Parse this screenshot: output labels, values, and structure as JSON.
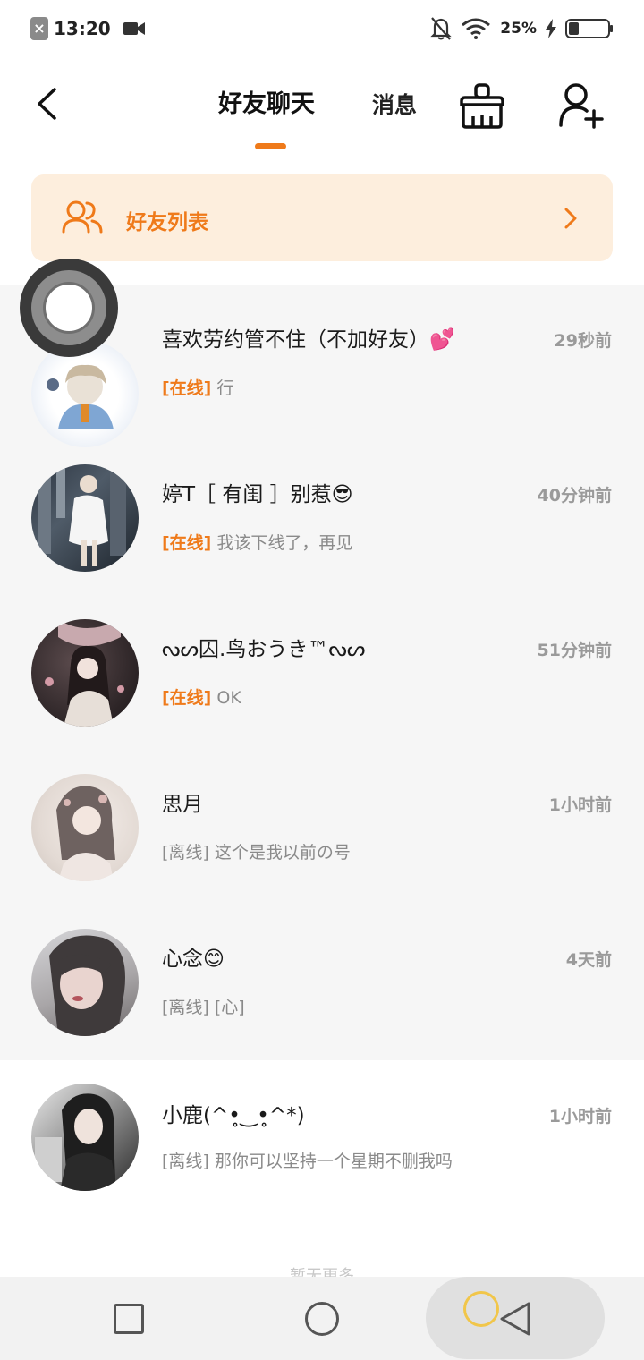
{
  "status_bar": {
    "time": "13:20",
    "battery": "25%"
  },
  "header": {
    "back_icon": "chevron-left-icon",
    "tab_active": "好友聊天",
    "tab_messages": "消息",
    "clean_icon": "broom-icon",
    "add_friend_icon": "add-user-icon"
  },
  "banner": {
    "label": "好友列表",
    "icon": "users-icon"
  },
  "chats": [
    {
      "name": "喜欢劳约管不住（不加好友）💕",
      "time": "29秒前",
      "status": "[在线]",
      "online": true,
      "message": "行"
    },
    {
      "name": "婷T［ 有闺 ］别惹😎",
      "time": "40分钟前",
      "status": "[在线]",
      "online": true,
      "message": "我该下线了，再见"
    },
    {
      "name": "ᔓᔕ囚.鸟おうき™ᔓᔕ",
      "time": "51分钟前",
      "status": "[在线]",
      "online": true,
      "message": "OK"
    },
    {
      "name": "思月",
      "time": "1小时前",
      "status": "[离线]",
      "online": false,
      "message": "这个是我以前の号"
    },
    {
      "name": "心念😊",
      "time": "4天前",
      "status": "[离线]",
      "online": false,
      "message": "[心]"
    },
    {
      "name": "小鹿(^•̥‿•̥^*) ؘ",
      "time": "1小时前",
      "status": "[离线]",
      "online": false,
      "message": "那你可以坚持一个星期不删我吗"
    }
  ],
  "footer": {
    "more_text": "暂无更多"
  },
  "colors": {
    "accent": "#ef7a1a",
    "banner_bg": "#fdeedd",
    "list_bg": "#f6f6f6"
  }
}
